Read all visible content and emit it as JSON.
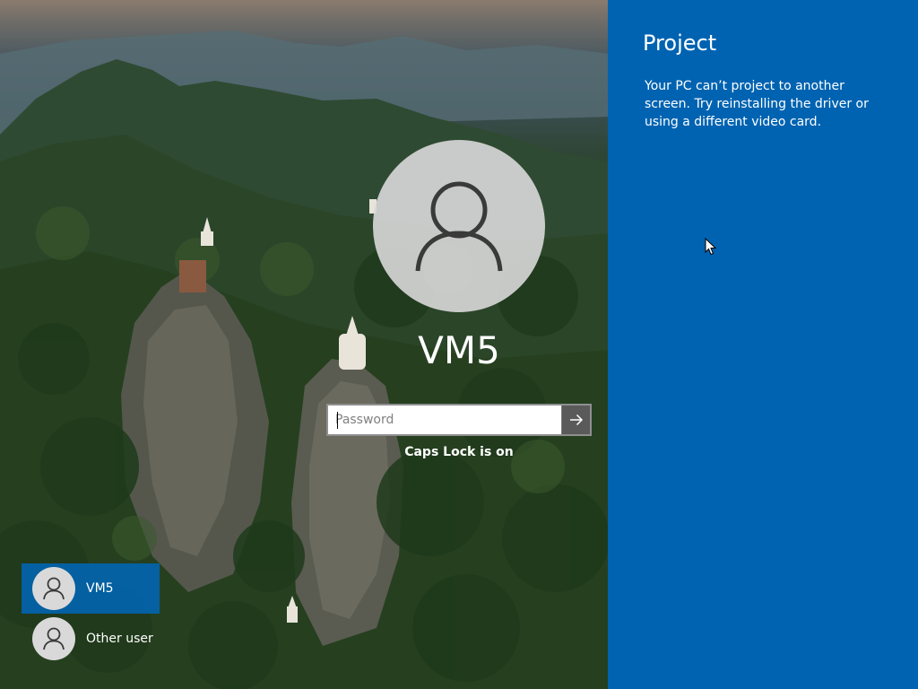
{
  "login": {
    "username": "VM5",
    "password_placeholder": "Password",
    "password_value": "",
    "caps_lock_message": "Caps Lock is on",
    "submit_icon": "arrow-right-icon"
  },
  "user_list": [
    {
      "name": "VM5",
      "selected": true,
      "icon": "user-icon"
    },
    {
      "name": "Other user",
      "selected": false,
      "icon": "user-icon"
    }
  ],
  "project_panel": {
    "title": "Project",
    "message": "Your PC can’t project to another screen. Try reinstalling the driver or using a different video card.",
    "background_color": "#0063b1"
  },
  "colors": {
    "selected_user_bg": "#0067b8",
    "avatar_bg": "#d6d6d6",
    "submit_bg": "#5a5a5a"
  }
}
